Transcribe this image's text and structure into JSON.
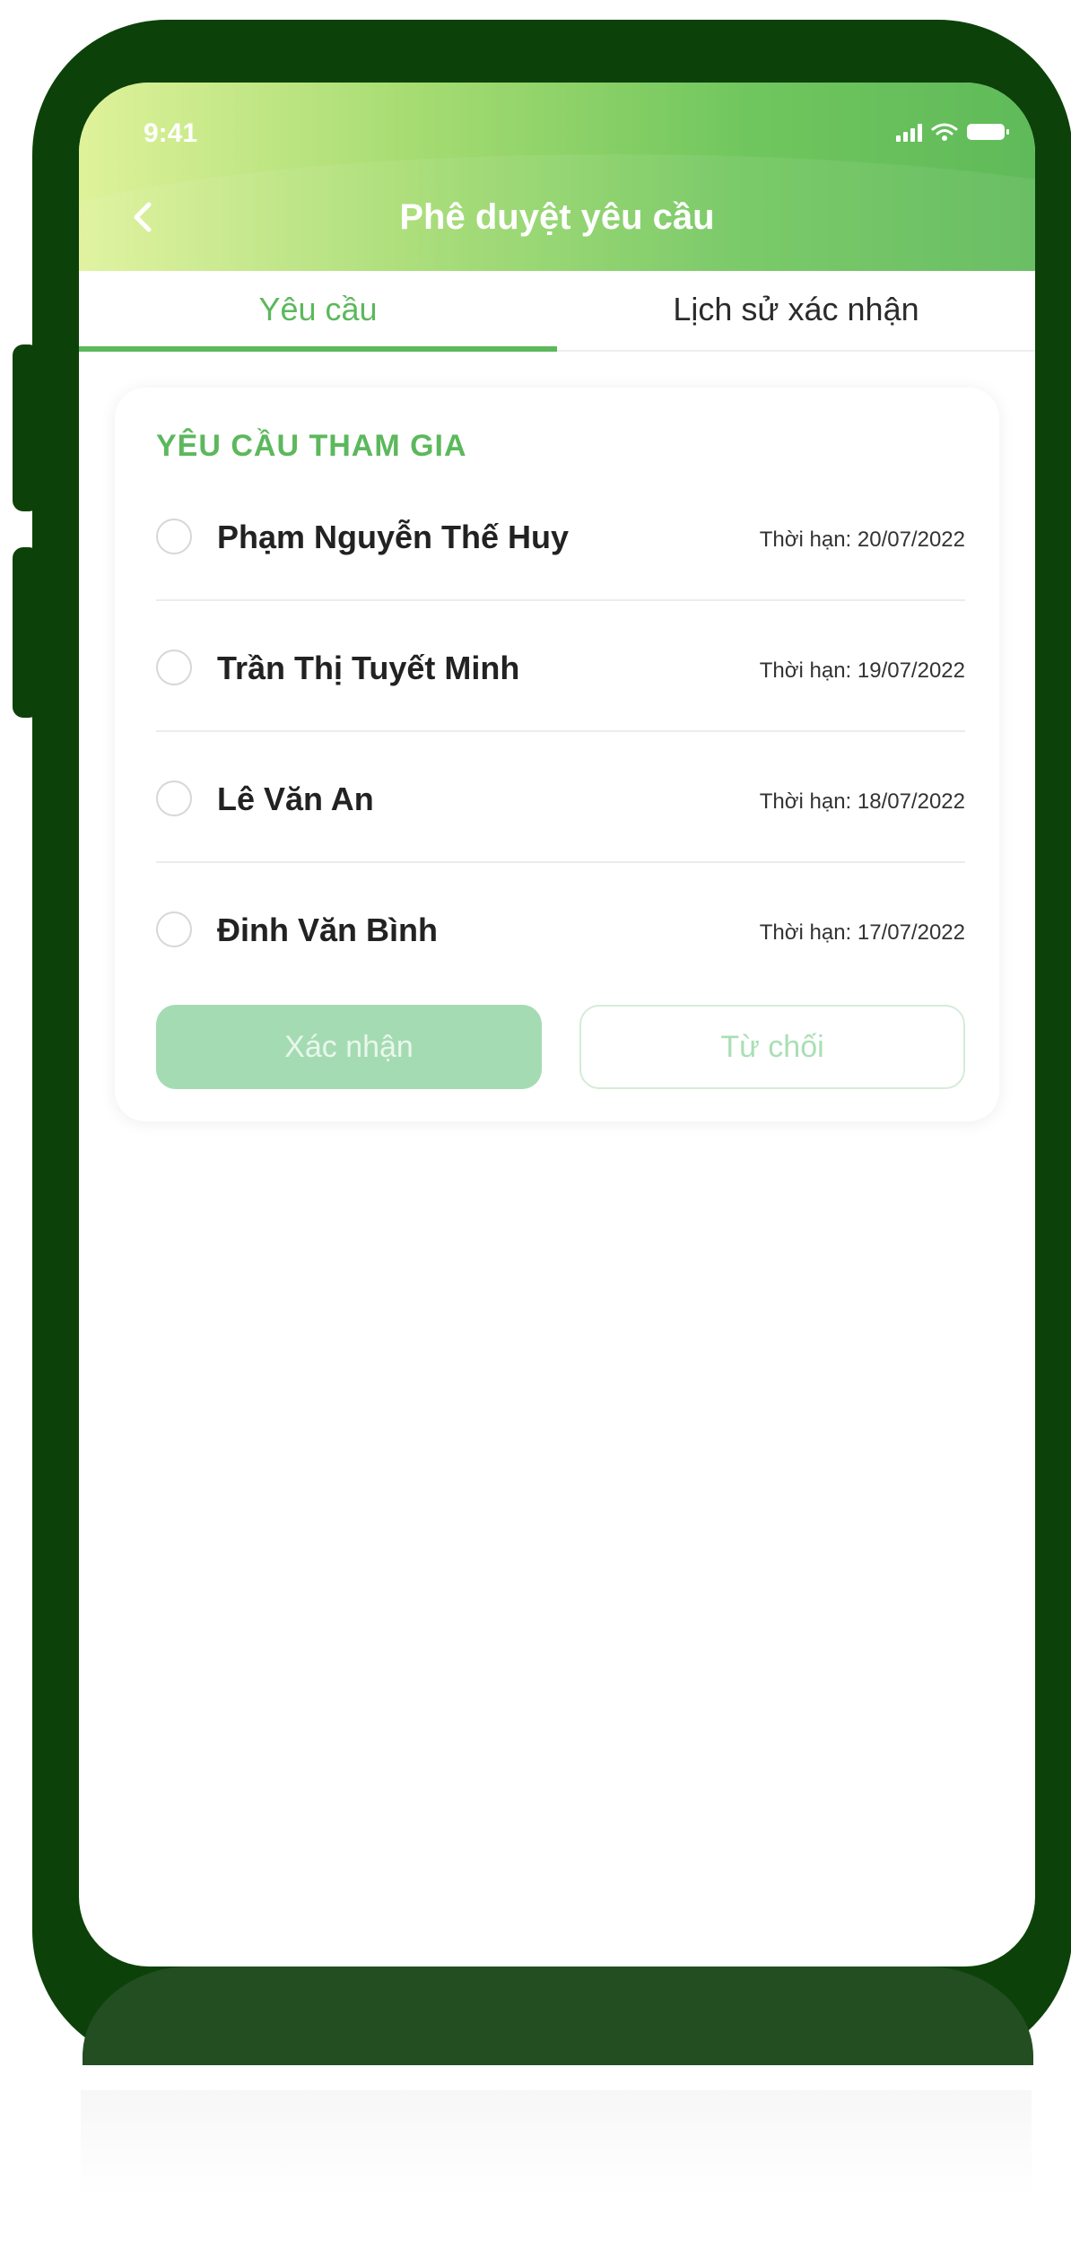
{
  "status_bar": {
    "time": "9:41",
    "icons": [
      "signal-icon",
      "wifi-icon",
      "battery-icon"
    ]
  },
  "header": {
    "title": "Phê duyệt yêu cầu",
    "back_icon": "chevron-left-icon"
  },
  "tabs": [
    {
      "label": "Yêu cầu",
      "active": true
    },
    {
      "label": "Lịch sử xác nhận",
      "active": false
    }
  ],
  "requests": {
    "section_title": "YÊU CẦU THAM GIA",
    "items": [
      {
        "name": "Phạm Nguyễn Thế Huy",
        "deadline": "Thời hạn: 20/07/2022",
        "checked": false
      },
      {
        "name": "Trần Thị Tuyết Minh",
        "deadline": "Thời hạn: 19/07/2022",
        "checked": false
      },
      {
        "name": "Lê Văn An",
        "deadline": "Thời hạn: 18/07/2022",
        "checked": false
      },
      {
        "name": "Đinh Văn Bình",
        "deadline": "Thời hạn: 17/07/2022",
        "checked": false
      }
    ]
  },
  "actions": {
    "confirm_label": "Xác nhận",
    "reject_label": "Từ chối"
  },
  "colors": {
    "accent": "#5cb85c",
    "frame": "#0c4209",
    "confirm_disabled": "#a5dbb2"
  }
}
